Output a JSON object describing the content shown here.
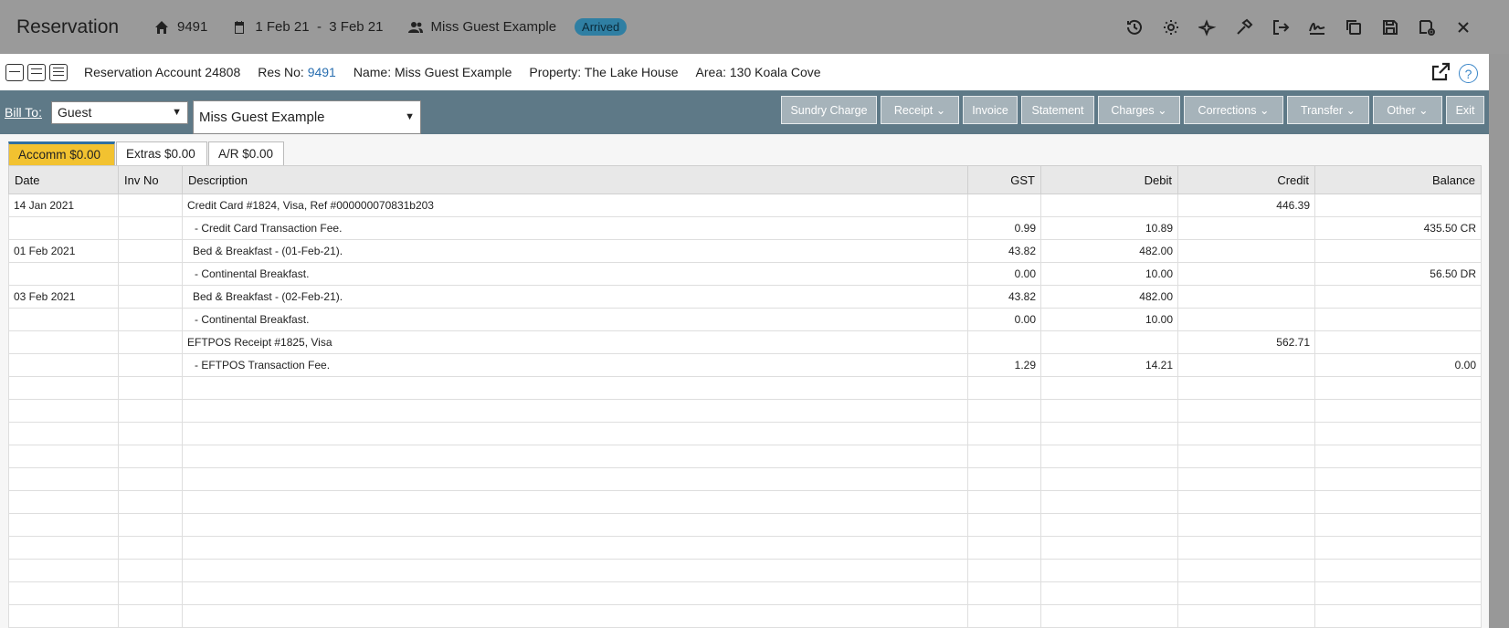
{
  "header": {
    "title": "Reservation",
    "res_no": "9491",
    "dates_from": "1 Feb 21",
    "dates_sep": "-",
    "dates_to": "3 Feb 21",
    "guest": "Miss Guest Example",
    "status": "Arrived",
    "status_color": "#2f7fa3"
  },
  "info": {
    "account": "Reservation Account 24808",
    "res_no_label": "Res No:",
    "res_no": "9491",
    "name": "Name: Miss Guest Example",
    "property": "Property: The Lake House",
    "area": "Area: 130 Koala Cove",
    "help": "?"
  },
  "toolbar": {
    "bill_to": "Bill To:",
    "bill_type": "Guest",
    "bill_name": "Miss Guest Example",
    "buttons": {
      "sundry": "Sundry Charge",
      "receipt": "Receipt",
      "invoice": "Invoice",
      "statement": "Statement",
      "charges": "Charges",
      "corrections": "Corrections",
      "transfer": "Transfer",
      "other": "Other",
      "exit": "Exit"
    }
  },
  "tabs": {
    "accomm": "Accomm $0.00",
    "extras": "Extras $0.00",
    "ar": "A/R $0.00"
  },
  "columns": {
    "date": "Date",
    "inv": "Inv No",
    "desc": "Description",
    "gst": "GST",
    "debit": "Debit",
    "credit": "Credit",
    "balance": "Balance"
  },
  "rows": [
    {
      "date": "14 Jan 2021",
      "inv": "",
      "desc": "Credit Card #1824, Visa, Ref #000000070831b203",
      "gst": "",
      "debit": "",
      "credit": "446.39",
      "balance": ""
    },
    {
      "date": "",
      "inv": "",
      "desc": " - Credit Card Transaction Fee.",
      "gst": "0.99",
      "debit": "10.89",
      "credit": "",
      "balance": "435.50 CR"
    },
    {
      "date": "01 Feb 2021",
      "inv": "",
      "desc": "Bed & Breakfast  - (01-Feb-21).",
      "gst": "43.82",
      "debit": "482.00",
      "credit": "",
      "balance": ""
    },
    {
      "date": "",
      "inv": "",
      "desc": " - Continental Breakfast.",
      "gst": "0.00",
      "debit": "10.00",
      "credit": "",
      "balance": "56.50 DR"
    },
    {
      "date": "03 Feb 2021",
      "inv": "",
      "desc": "Bed & Breakfast  - (02-Feb-21).",
      "gst": "43.82",
      "debit": "482.00",
      "credit": "",
      "balance": ""
    },
    {
      "date": "",
      "inv": "",
      "desc": " - Continental Breakfast.",
      "gst": "0.00",
      "debit": "10.00",
      "credit": "",
      "balance": ""
    },
    {
      "date": "",
      "inv": "",
      "desc": "EFTPOS Receipt #1825, Visa",
      "gst": "",
      "debit": "",
      "credit": "562.71",
      "balance": ""
    },
    {
      "date": "",
      "inv": "",
      "desc": " - EFTPOS Transaction Fee.",
      "gst": "1.29",
      "debit": "14.21",
      "credit": "",
      "balance": "0.00"
    }
  ]
}
